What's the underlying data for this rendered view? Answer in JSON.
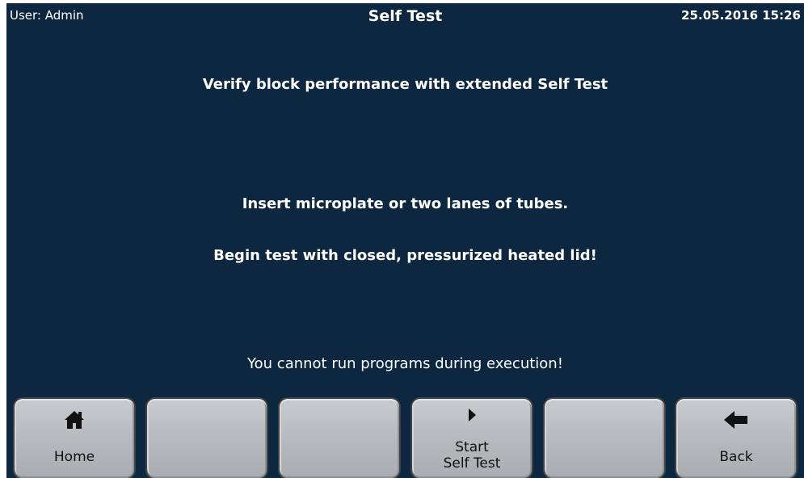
{
  "status_bar": {
    "user": "User: Admin",
    "title": "Self Test",
    "datetime": "25.05.2016  15:26"
  },
  "messages": {
    "verify": "Verify block performance with extended Self Test",
    "insert": "Insert microplate or two lanes of tubes.",
    "begin": "Begin test with closed, pressurized heated lid!",
    "warning": "You cannot run programs during execution!"
  },
  "softkeys": [
    {
      "label": "Home",
      "icon": "home-icon"
    },
    {
      "label": "",
      "icon": ""
    },
    {
      "label": "",
      "icon": ""
    },
    {
      "label_line1": "Start",
      "label_line2": "Self Test",
      "icon": "play-icon"
    },
    {
      "label": "",
      "icon": ""
    },
    {
      "label": "Back",
      "icon": "arrow-left-icon"
    }
  ],
  "colors": {
    "background": "#0e2740",
    "text": "#ffffff",
    "button_face": "#bcbfc2",
    "button_text": "#101010"
  }
}
